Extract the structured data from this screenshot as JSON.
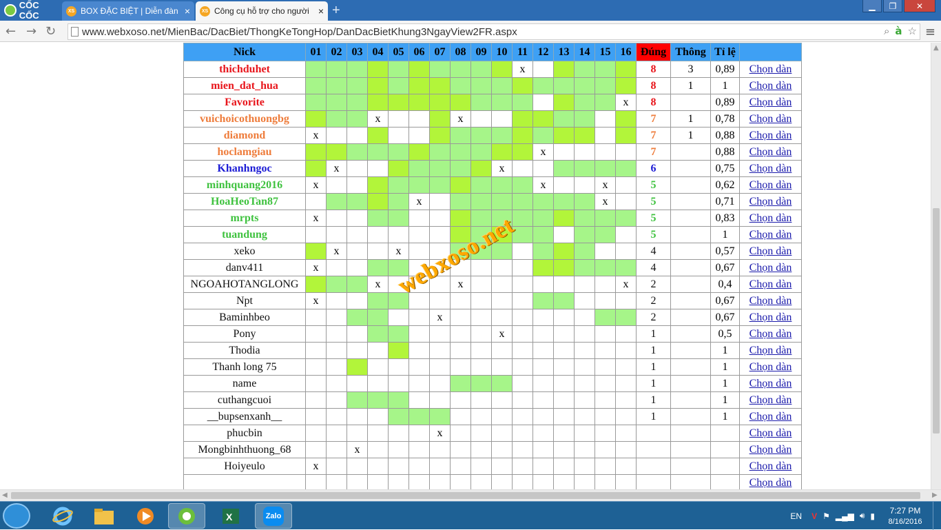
{
  "browser": {
    "brand": "CỐC CỐC",
    "tabs": [
      {
        "favicon": "XS",
        "title": "BOX ĐẶC BIỆT | Diễn đàn",
        "close": "×"
      },
      {
        "favicon": "XS",
        "title": "Công cụ hỗ trợ cho người",
        "close": "×"
      }
    ],
    "new_tab": "+",
    "window_buttons": [
      "▁",
      "❐",
      "✕"
    ],
    "url": "www.webxoso.net/MienBac/DacBiet/ThongKeTongHop/DanDacBietKhung3NgayView2FR.aspx",
    "nav_icons": [
      "back-arrow-icon",
      "forward-arrow-icon",
      "reload-icon"
    ]
  },
  "table": {
    "headers": {
      "nick": "Nick",
      "cols": [
        "01",
        "02",
        "03",
        "04",
        "05",
        "06",
        "07",
        "08",
        "09",
        "10",
        "11",
        "12",
        "13",
        "14",
        "15",
        "16"
      ],
      "dung": "Đúng",
      "thong": "Thông",
      "tile": "Tỉ lệ"
    },
    "link_label": "Chọn dàn",
    "colors": {
      "header": "#3ea0f4",
      "dung_header": "#ff0000",
      "light_green": "#a6f589",
      "lime": "#b2f53a"
    },
    "rows": [
      {
        "nick": "thichduhet",
        "color": "red",
        "cells": "LLLDLDLLLDx.DLLD",
        "dung": "8",
        "thong": "3",
        "tile": "0,89"
      },
      {
        "nick": "mien_dat_hua",
        "color": "red",
        "cells": "LLLDLDDLLLDLLLLD",
        "dung": "8",
        "thong": "1",
        "tile": "1"
      },
      {
        "nick": "Favorite",
        "color": "red",
        "cells": "LLLDDDDDLLL.DLLx",
        "dung": "8",
        "thong": "",
        "tile": "0,89"
      },
      {
        "nick": "vuichoicothuongbg",
        "color": "orange",
        "cells": "DLLx..Dx..DDLL.D",
        "dung": "7",
        "thong": "1",
        "tile": "0,78"
      },
      {
        "nick": "diamond",
        "color": "orange",
        "cells": "x..D..DLLLDLDD.D",
        "dung": "7",
        "thong": "1",
        "tile": "0,88"
      },
      {
        "nick": "hoclamgiau",
        "color": "orange",
        "cells": "DDLLLDLLLDDx....",
        "dung": "7",
        "thong": "",
        "tile": "0,88"
      },
      {
        "nick": "Khanhngoc",
        "color": "blue",
        "cells": "Dx..DLLLDx..LLLL",
        "dung": "6",
        "thong": "",
        "tile": "0,75"
      },
      {
        "nick": "minhquang2016",
        "color": "green",
        "cells": "x..DLLLDLLLx..x.",
        "dung": "5",
        "thong": "",
        "tile": "0,62"
      },
      {
        "nick": "HoaHeoTan87",
        "color": "green",
        "cells": ".LLDLx.LLLLLLLx.",
        "dung": "5",
        "thong": "",
        "tile": "0,71"
      },
      {
        "nick": "mrpts",
        "color": "green",
        "cells": "x..LL..DLLLLDLLL",
        "dung": "5",
        "thong": "",
        "tile": "0,83"
      },
      {
        "nick": "tuandung",
        "color": "green",
        "cells": ".......DLDLL.LL.",
        "dung": "5",
        "thong": "",
        "tile": "1"
      },
      {
        "nick": "xeko",
        "color": "black",
        "cells": "Dx..x..LLL.LDL..",
        "dung": "4",
        "thong": "",
        "tile": "0,57"
      },
      {
        "nick": "danv411",
        "color": "black",
        "cells": "x..LL......DDLLL",
        "dung": "4",
        "thong": "",
        "tile": "0,67"
      },
      {
        "nick": "NGOAHOTANGLONG",
        "color": "black",
        "cells": "DLLx...x.......x",
        "dung": "2",
        "thong": "",
        "tile": "0,4"
      },
      {
        "nick": "Npt",
        "color": "black",
        "cells": "x..LL......LL...",
        "dung": "2",
        "thong": "",
        "tile": "0,67"
      },
      {
        "nick": "Baminhbeo",
        "color": "black",
        "cells": "..LL..x.......LL",
        "dung": "2",
        "thong": "",
        "tile": "0,67"
      },
      {
        "nick": "Pony",
        "color": "black",
        "cells": "...LL....x......",
        "dung": "1",
        "thong": "",
        "tile": "0,5"
      },
      {
        "nick": "Thodia",
        "color": "black",
        "cells": "....D...........",
        "dung": "1",
        "thong": "",
        "tile": "1"
      },
      {
        "nick": "Thanh long 75",
        "color": "black",
        "cells": "..D.............",
        "dung": "1",
        "thong": "",
        "tile": "1"
      },
      {
        "nick": "name",
        "color": "black",
        "cells": ".......LLL......",
        "dung": "1",
        "thong": "",
        "tile": "1"
      },
      {
        "nick": "cuthangcuoi",
        "color": "black",
        "cells": "..LLL...........",
        "dung": "1",
        "thong": "",
        "tile": "1"
      },
      {
        "nick": "__bupsenxanh__",
        "color": "black",
        "cells": "....LLL.........",
        "dung": "1",
        "thong": "",
        "tile": "1"
      },
      {
        "nick": "phucbin",
        "color": "black",
        "cells": "......x.........",
        "dung": "",
        "thong": "",
        "tile": ""
      },
      {
        "nick": "Mongbinhthuong_68",
        "color": "black",
        "cells": "..x.............",
        "dung": "",
        "thong": "",
        "tile": ""
      },
      {
        "nick": "Hoiyeulo",
        "color": "black",
        "cells": "x...............",
        "dung": "",
        "thong": "",
        "tile": ""
      },
      {
        "nick": "",
        "color": "black",
        "cells": "................",
        "dung": "",
        "thong": "",
        "tile": ""
      }
    ]
  },
  "watermark": "webxoso.net",
  "taskbar": {
    "apps": [
      "internet-explorer-icon",
      "file-explorer-icon",
      "media-player-icon",
      "coccoc-icon",
      "excel-icon",
      "zalo-icon"
    ],
    "zalo_label": "Zalo",
    "lang": "EN",
    "time": "7:27 PM",
    "date": "8/16/2016"
  }
}
